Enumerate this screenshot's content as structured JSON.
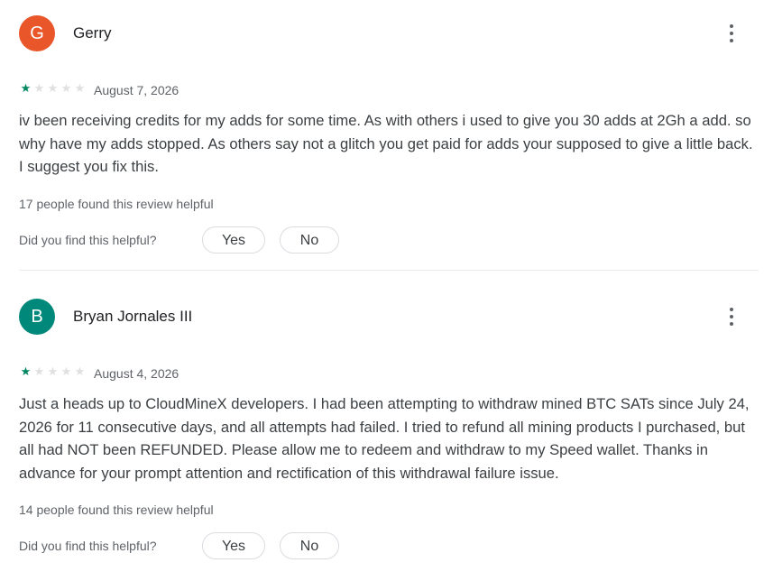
{
  "reviews": [
    {
      "avatar_letter": "G",
      "avatar_color": "#e8562a",
      "author": "Gerry",
      "rating": 1,
      "rating_max": 5,
      "date": "August 7, 2026",
      "text": "iv been receiving credits for my adds for some time. As with others i used to give you 30 adds at 2Gh a add. so why have my adds stopped. As others say not a glitch you get paid for adds your supposed to give a little back. I suggest you fix this.",
      "helpful_count_text": "17 people found this review helpful",
      "helpful_question": "Did you find this helpful?",
      "yes_label": "Yes",
      "no_label": "No",
      "more_icon": "more-vert-icon"
    },
    {
      "avatar_letter": "B",
      "avatar_color": "#00897b",
      "author": "Bryan Jornales III",
      "rating": 1,
      "rating_max": 5,
      "date": "August 4, 2026",
      "text": "Just a heads up to CloudMineX developers. I had been attempting to withdraw mined BTC SATs since July 24, 2026 for 11 consecutive days, and all attempts had failed. I tried to refund all mining products I purchased, but all had NOT been REFUNDED. Please allow me to redeem and withdraw to my Speed wallet. Thanks in advance for your prompt attention and rectification of this withdrawal failure issue.",
      "helpful_count_text": "14 people found this review helpful",
      "helpful_question": "Did you find this helpful?",
      "yes_label": "Yes",
      "no_label": "No",
      "more_icon": "more-vert-icon"
    }
  ],
  "colors": {
    "star_filled": "#01875f",
    "star_empty": "#e0e0e0"
  }
}
